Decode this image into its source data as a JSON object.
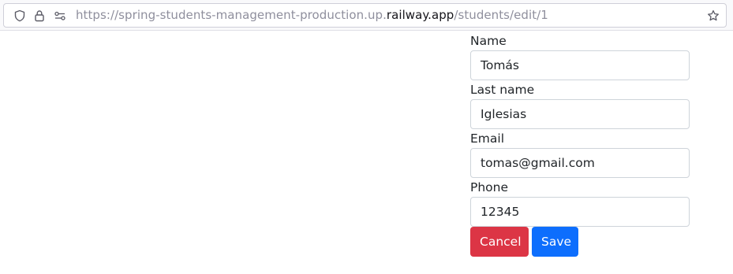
{
  "browser": {
    "url_prefix": "https://spring-students-management-production.up.",
    "url_host": "railway.app",
    "url_path": "/students/edit/1"
  },
  "form": {
    "fields": [
      {
        "label": "Name",
        "value": "Tomás"
      },
      {
        "label": "Last name",
        "value": "Iglesias"
      },
      {
        "label": "Email",
        "value": "tomas@gmail.com"
      },
      {
        "label": "Phone",
        "value": "12345"
      }
    ],
    "cancel_label": "Cancel",
    "save_label": "Save"
  },
  "colors": {
    "cancel": "#dc3545",
    "save": "#0d6efd"
  },
  "icons": [
    "shield-icon",
    "lock-icon",
    "permissions-icon",
    "bookmark-star-icon"
  ]
}
